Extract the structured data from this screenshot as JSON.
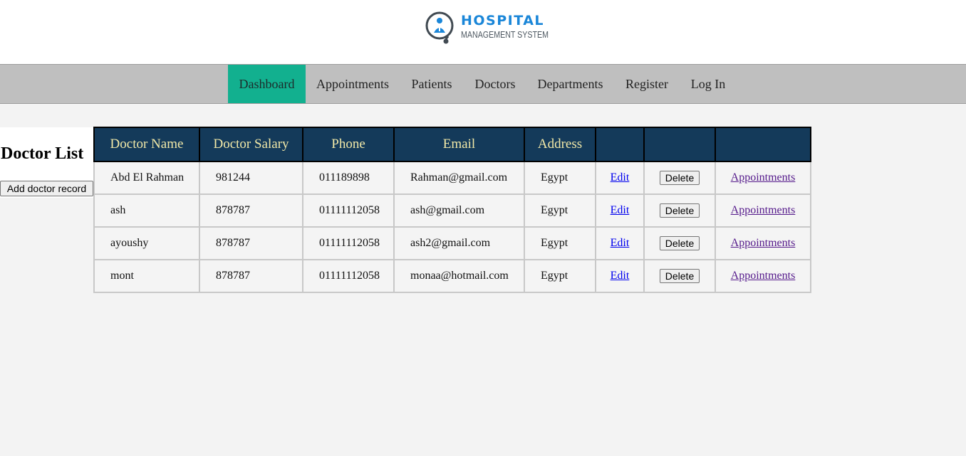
{
  "brand": {
    "title": "HOSPITAL",
    "subtitle": "MANAGEMENT SYSTEM",
    "color": "#1a86d8"
  },
  "nav": {
    "items": [
      {
        "label": "Dashboard",
        "active": true
      },
      {
        "label": "Appointments"
      },
      {
        "label": "Patients"
      },
      {
        "label": "Doctors"
      },
      {
        "label": "Departments"
      },
      {
        "label": "Register"
      },
      {
        "label": "Log In"
      }
    ],
    "active_color": "#12b08f"
  },
  "page": {
    "title": "Doctor List",
    "add_button": "Add doctor record"
  },
  "table": {
    "headers": [
      "Doctor Name",
      "Doctor Salary",
      "Phone",
      "Email",
      "Address",
      "",
      "",
      ""
    ],
    "header_bg": "#143a5a",
    "header_text_color": "#f2e9a8",
    "rows": [
      {
        "name": "Abd El Rahman",
        "salary": "981244",
        "phone": "011189898",
        "email": "Rahman@gmail.com",
        "address": "Egypt",
        "edit": "Edit",
        "delete": "Delete",
        "appointments": "Appointments"
      },
      {
        "name": "ash",
        "salary": "878787",
        "phone": "01111112058",
        "email": "ash@gmail.com",
        "address": "Egypt",
        "edit": "Edit",
        "delete": "Delete",
        "appointments": "Appointments"
      },
      {
        "name": "ayoushy",
        "salary": "878787",
        "phone": "01111112058",
        "email": "ash2@gmail.com",
        "address": "Egypt",
        "edit": "Edit",
        "delete": "Delete",
        "appointments": "Appointments"
      },
      {
        "name": "mont",
        "salary": "878787",
        "phone": "01111112058",
        "email": "monaa@hotmail.com",
        "address": "Egypt",
        "edit": "Edit",
        "delete": "Delete",
        "appointments": "Appointments"
      }
    ]
  }
}
